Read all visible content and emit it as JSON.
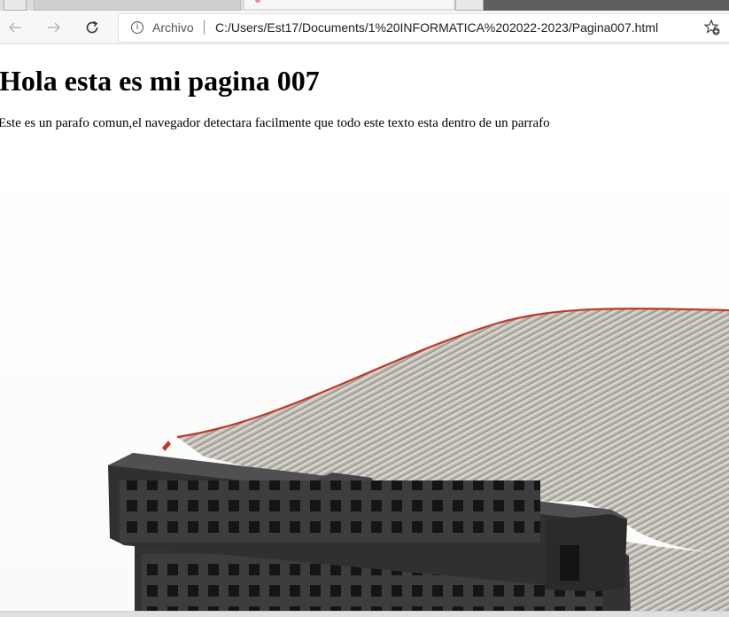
{
  "browser": {
    "address_bar": {
      "scheme_label": "Archivo",
      "url": "C:/Users/Est17/Documents/1%20INFORMATICA%202022-2023/Pagina007.html"
    },
    "icons": {
      "back": "back-arrow-icon",
      "forward": "forward-arrow-icon",
      "reload": "reload-icon",
      "info": "info-icon",
      "favorite": "add-favorite-star-icon"
    }
  },
  "page": {
    "heading": "Hola esta es mi pagina 007",
    "paragraph": "Este es un parafo comun,el navegador detectara facilmente que todo este texto esta dentro de un parrafo",
    "image": {
      "subject": "ribbon-cable-with-connectors"
    }
  },
  "colors": {
    "cable": "#b5b1aa",
    "connector": "#3a3a3a",
    "red_stripe": "#c0392b"
  }
}
